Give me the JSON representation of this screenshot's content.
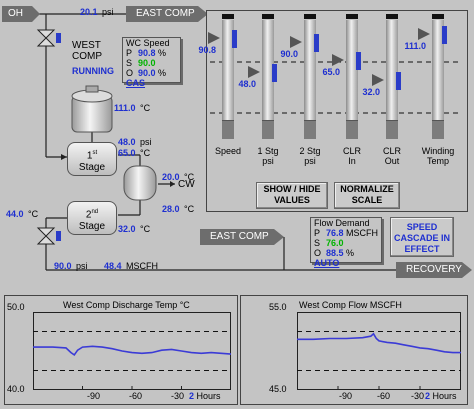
{
  "header": {
    "oh_tag": "OH",
    "discharge_psi": "20.1",
    "psi_unit": "psi",
    "east_comp_tag": "EAST COMP"
  },
  "compressor": {
    "name_line1": "WEST",
    "name_line2": "COMP",
    "status": "RUNNING",
    "motor_temp": "111.0",
    "temp_unit": "°C"
  },
  "wc_speed": {
    "title": "WC Speed",
    "rows": [
      {
        "key": "P",
        "value": "90.8",
        "unit": "%"
      },
      {
        "key": "S",
        "value": "90.0",
        "unit": ""
      },
      {
        "key": "O",
        "value": "90.0",
        "unit": "%"
      }
    ],
    "mode": "CAS"
  },
  "stage1": {
    "num": "1",
    "suffix": "st",
    "label": "Stage",
    "psi": "48.0",
    "temp": "65.0"
  },
  "stage2": {
    "num": "2",
    "suffix": "nd",
    "label": "Stage",
    "out_temp": "44.0",
    "in_temp": "32.0"
  },
  "cooler": {
    "temp_in": "20.0",
    "temp_out": "28.0",
    "cw_label": "CW"
  },
  "bottom_line": {
    "psi": "90.0",
    "psi_unit": "psi",
    "flow": "48.4",
    "flow_unit": "MSCFH",
    "east_comp_tag": "EAST COMP",
    "recovery_tag": "RECOVERY"
  },
  "indicators": [
    {
      "label": "Speed",
      "value": "90.8",
      "fill": 0.82
    },
    {
      "label": "1 Stg\npsi",
      "value": "48.0",
      "fill": 0.48
    },
    {
      "label": "2 Stg\npsi",
      "value": "90.0",
      "fill": 0.78
    },
    {
      "label": "CLR\nIn",
      "value": "65.0",
      "fill": 0.6
    },
    {
      "label": "CLR\nOut",
      "value": "32.0",
      "fill": 0.4
    },
    {
      "label": "Winding\nTemp",
      "value": "111.0",
      "fill": 0.86
    }
  ],
  "buttons": {
    "show_hide": "SHOW / HIDE VALUES",
    "normalize": "NORMALIZE SCALE",
    "speed_cascade": "SPEED CASCADE IN EFFECT"
  },
  "flow_demand": {
    "title": "Flow Demand",
    "rows": [
      {
        "key": "P",
        "value": "76.8",
        "unit": "MSCFH"
      },
      {
        "key": "S",
        "value": "76.0",
        "unit": ""
      },
      {
        "key": "O",
        "value": "88.5",
        "unit": "%"
      }
    ],
    "mode": "AUTO"
  },
  "chart_data": [
    {
      "type": "line",
      "title": "West Comp Discharge Temp °C",
      "ylim": [
        40.0,
        50.0
      ],
      "y_ticks": [
        "50.0",
        "40.0"
      ],
      "x_ticks": [
        "-90",
        "-60",
        "-30"
      ],
      "x_unit_value": "2",
      "x_unit_label": "Hours",
      "limit_lines": [
        47.5,
        42.5
      ],
      "x": [
        -120,
        -108,
        -100,
        -97,
        -95,
        -93,
        -90,
        -84,
        -78,
        -72,
        -66,
        -60,
        -54,
        -48,
        -42,
        -36,
        -30,
        -24,
        -18,
        -12,
        -6,
        0
      ],
      "series": [
        {
          "values": [
            45.5,
            45.5,
            45.4,
            44.8,
            44.5,
            45.1,
            45.5,
            45.6,
            45.5,
            45.3,
            45.0,
            44.8,
            44.7,
            44.8,
            45.1,
            45.2,
            45.0,
            44.8,
            44.7,
            44.8,
            44.7,
            44.6
          ]
        }
      ]
    },
    {
      "type": "line",
      "title": "West Comp Flow MSCFH",
      "ylim": [
        45.0,
        55.0
      ],
      "y_ticks": [
        "55.0",
        "45.0"
      ],
      "x_ticks": [
        "-90",
        "-60",
        "-30"
      ],
      "x_unit_value": "2",
      "x_unit_label": "Hours",
      "limit_lines": [
        52.5,
        47.5
      ],
      "x": [
        -120,
        -108,
        -96,
        -84,
        -72,
        -66,
        -64,
        -62,
        -60,
        -54,
        -48,
        -42,
        -36,
        -30,
        -24,
        -18,
        -12,
        -6,
        0
      ],
      "series": [
        {
          "values": [
            51.5,
            51.5,
            51.6,
            51.6,
            51.7,
            51.9,
            52.2,
            51.6,
            51.3,
            51.1,
            51.0,
            50.8,
            50.6,
            50.4,
            50.3,
            50.1,
            49.9,
            49.8,
            49.8
          ]
        }
      ]
    }
  ]
}
